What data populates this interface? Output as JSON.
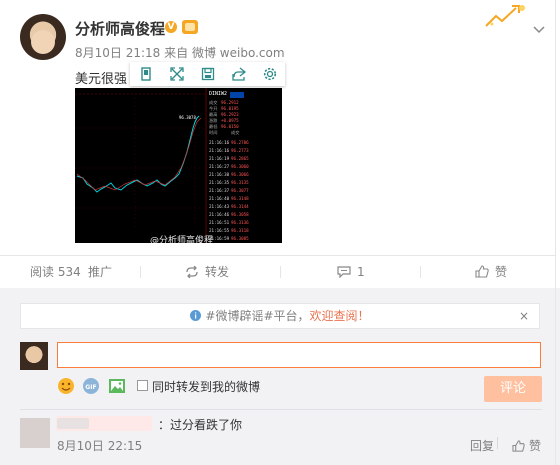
{
  "post": {
    "author": "分析师高俊程",
    "verified_badge": "V",
    "time": "8月10日 21:18",
    "source_prefix": "来自",
    "source": "微博 weibo.com",
    "text": "美元很强"
  },
  "chart_image": {
    "watermark": "@分析师高俊程",
    "panel_title": "DINIW2",
    "price_label": "96.3078"
  },
  "actions": {
    "reads": "阅读 534",
    "promote": "推广",
    "repost": "转发",
    "comments": "1",
    "like": "赞"
  },
  "comment_box": {
    "notice_prefix": "#微博辟谣#平台，",
    "notice_highlight": "欢迎查阅！",
    "close": "×",
    "checkbox_label": "同时转发到我的微博",
    "submit": "评论",
    "input_value": ""
  },
  "comments": [
    {
      "text": "：过分看跌了你",
      "time": "8月10日 22:15",
      "reply": "回复",
      "like": "赞"
    }
  ],
  "colors": {
    "accent": "#eb7350",
    "input_border": "#fa7d3c",
    "submit_bg": "#ffc09f"
  }
}
